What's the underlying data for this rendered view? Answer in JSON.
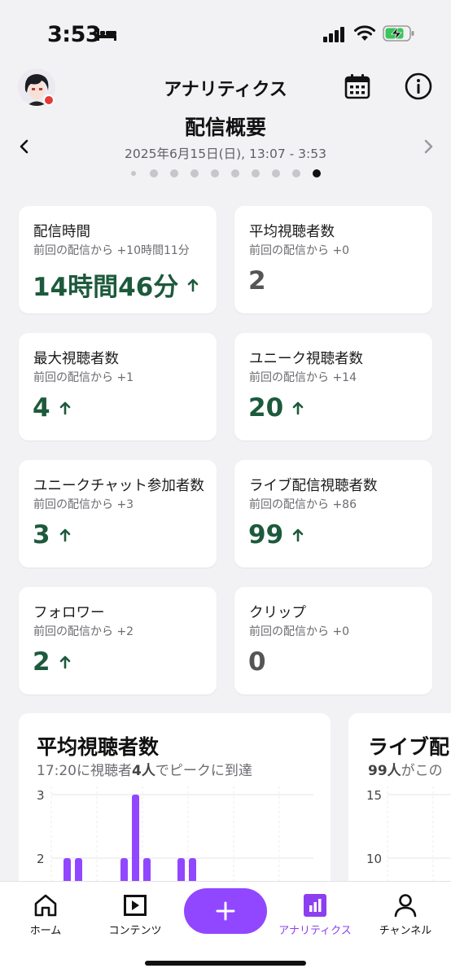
{
  "status_bar": {
    "time": "3:53"
  },
  "header": {
    "title": "アナリティクス"
  },
  "overview": {
    "title": "配信概要",
    "date": "2025年6月15日(日), 13:07 - 3:53",
    "page_count": 10,
    "active_page": 10
  },
  "cards": [
    {
      "title": "配信時間",
      "sub": "前回の配信から +10時間11分",
      "value": "14時間46分",
      "trend": "up"
    },
    {
      "title": "平均視聴者数",
      "sub": "前回の配信から +0",
      "value": "2",
      "trend": "none"
    },
    {
      "title": "最大視聴者数",
      "sub": "前回の配信から +1",
      "value": "4",
      "trend": "up"
    },
    {
      "title": "ユニーク視聴者数",
      "sub": "前回の配信から +14",
      "value": "20",
      "trend": "up"
    },
    {
      "title": "ユニークチャット参加者数",
      "sub": "前回の配信から +3",
      "value": "3",
      "trend": "up"
    },
    {
      "title": "ライブ配信視聴者数",
      "sub": "前回の配信から +86",
      "value": "99",
      "trend": "up"
    },
    {
      "title": "フォロワー",
      "sub": "前回の配信から +2",
      "value": "2",
      "trend": "up"
    },
    {
      "title": "クリップ",
      "sub": "前回の配信から +0",
      "value": "0",
      "trend": "none"
    }
  ],
  "chart_card_1": {
    "title": "平均視聴者数",
    "sub_time": "17:20に視聴者",
    "sub_count": "4人",
    "sub_rest": "でピークに到達"
  },
  "chart_card_2": {
    "title": "ライブ配",
    "sub_count": "99人",
    "sub_rest": "がこの"
  },
  "chart_data": [
    {
      "type": "bar",
      "title": "平均視聴者数",
      "ytick_labels": [
        "3",
        "2"
      ],
      "values": [
        2,
        2,
        0,
        0,
        0,
        2,
        3,
        2,
        0,
        0,
        2,
        2
      ],
      "color": "#9147ff"
    },
    {
      "type": "line",
      "title": "ライブ配",
      "ytick_labels": [
        "15",
        "10"
      ]
    }
  ],
  "tabs": [
    {
      "label": "ホーム",
      "icon": "home-icon"
    },
    {
      "label": "コンテンツ",
      "icon": "content-icon"
    },
    {
      "label": "アナリティクス",
      "icon": "analytics-icon",
      "active": true
    },
    {
      "label": "チャンネル",
      "icon": "person-icon"
    }
  ],
  "colors": {
    "accent": "#9147ff",
    "positive": "#1d5a3c",
    "neutral_value": "#555555"
  }
}
